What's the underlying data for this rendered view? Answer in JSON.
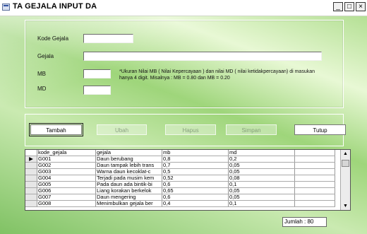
{
  "window": {
    "title": "TA GEJALA INPUT DA",
    "controls": [
      "_",
      "□",
      "×"
    ]
  },
  "form": {
    "kode_label": "Kode Gejala",
    "gejala_label": "Gejala",
    "mb_label": "MB",
    "md_label": "MD",
    "kode_value": "",
    "gejala_value": "",
    "mb_value": "",
    "md_value": "",
    "note": "*Ukuran Nilai MB ( Nilai Kepercayaan ) dan nilai MD ( nilai ketidakpercayaan) di masukan hanya 4 digit. Misalnya : MB = 0.80 dan MB = 0.20"
  },
  "buttons": {
    "tambah": "Tambah",
    "ubah": "Ubah",
    "hapus": "Hapus",
    "simpan": "Simpan",
    "tutup": "Tutup"
  },
  "grid": {
    "columns": [
      "kode_gejala",
      "gejala",
      "mb",
      "md"
    ],
    "rows": [
      {
        "kode": "G001",
        "gejala": "Daun berubang",
        "mb": "0,8",
        "md": "0,2"
      },
      {
        "kode": "G002",
        "gejala": "Daun tampak lebih trans",
        "mb": "0,7",
        "md": "0,05"
      },
      {
        "kode": "G003",
        "gejala": "Warna daun kecoklat-c",
        "mb": "0,5",
        "md": "0,05"
      },
      {
        "kode": "G004",
        "gejala": "Terjadi pada musim kem",
        "mb": "0,52",
        "md": "0,08"
      },
      {
        "kode": "G005",
        "gejala": "Pada daun ada bintik-bi",
        "mb": "0,6",
        "md": "0,1"
      },
      {
        "kode": "G006",
        "gejala": "Liang korakan berkelok",
        "mb": "0,65",
        "md": "0,05"
      },
      {
        "kode": "G007",
        "gejala": "Daun mengering",
        "mb": "0,6",
        "md": "0,05"
      },
      {
        "kode": "G008",
        "gejala": "Menimbulkan gejala ber",
        "mb": "0,4",
        "md": "0,1"
      }
    ]
  },
  "status": {
    "jumlah": "Jumlah : 80"
  }
}
